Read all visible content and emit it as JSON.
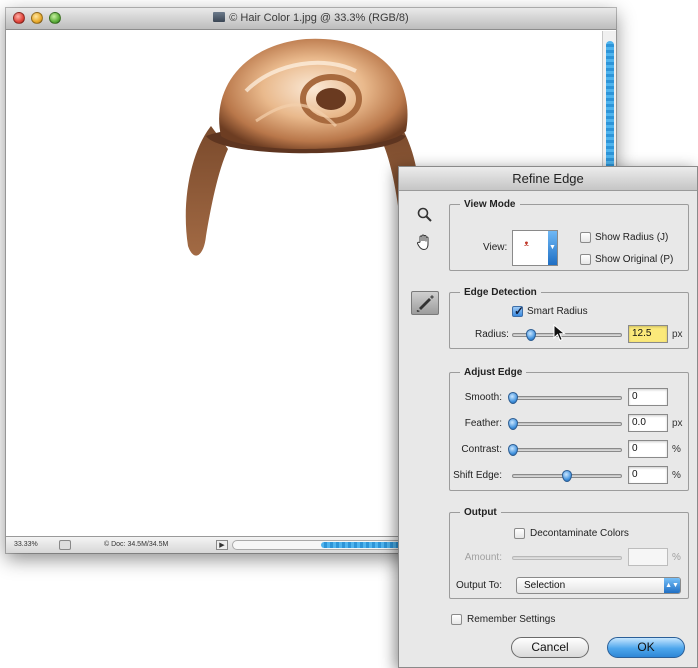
{
  "document": {
    "title": "© Hair Color 1.jpg @ 33.3% (RGB/8)",
    "status": {
      "zoom": "33.33%",
      "doc_info": "© Doc: 34.5M/34.5M"
    }
  },
  "refine_edge": {
    "title": "Refine Edge",
    "view_mode": {
      "legend": "View Mode",
      "view_label": "View:",
      "show_radius": {
        "label": "Show Radius (J)",
        "checked": false
      },
      "show_original": {
        "label": "Show Original (P)",
        "checked": false
      }
    },
    "edge_detection": {
      "legend": "Edge Detection",
      "smart_radius": {
        "label": "Smart Radius",
        "checked": true
      },
      "radius": {
        "label": "Radius:",
        "value": "12.5",
        "unit": "px",
        "slider_fraction": 0.17
      }
    },
    "adjust_edge": {
      "legend": "Adjust Edge",
      "smooth": {
        "label": "Smooth:",
        "value": "0",
        "unit": "",
        "slider_fraction": 0.0
      },
      "feather": {
        "label": "Feather:",
        "value": "0.0",
        "unit": "px",
        "slider_fraction": 0.0
      },
      "contrast": {
        "label": "Contrast:",
        "value": "0",
        "unit": "%",
        "slider_fraction": 0.0
      },
      "shift_edge": {
        "label": "Shift Edge:",
        "value": "0",
        "unit": "%",
        "slider_fraction": 0.5
      }
    },
    "output": {
      "legend": "Output",
      "decontaminate": {
        "label": "Decontaminate Colors",
        "checked": false
      },
      "amount": {
        "label": "Amount:",
        "value": "",
        "unit": "%"
      },
      "output_to": {
        "label": "Output To:",
        "value": "Selection"
      }
    },
    "remember_settings": {
      "label": "Remember Settings",
      "checked": false
    },
    "buttons": {
      "cancel": "Cancel",
      "ok": "OK"
    }
  },
  "icons": {
    "zoom_tool": "magnifier-icon",
    "hand_tool": "hand-icon",
    "refine_radius_tool": "brush-icon"
  },
  "colors": {
    "accent_blue": "#3a8ae0",
    "radius_highlight": "#fbe97a",
    "dialog_bg": "#e8e8e8"
  }
}
